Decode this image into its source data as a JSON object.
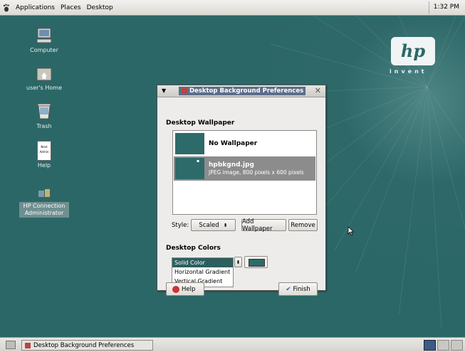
{
  "top_panel": {
    "menus": [
      "Applications",
      "Places",
      "Desktop"
    ],
    "clock": "1:32 PM"
  },
  "desktop_icons": [
    {
      "label": "Computer",
      "icon": "computer-icon"
    },
    {
      "label": "user's Home",
      "icon": "home-folder-icon"
    },
    {
      "label": "Trash",
      "icon": "trash-icon"
    },
    {
      "label": "Help",
      "icon": "help-document-icon"
    },
    {
      "label": "HP Connection Administrator",
      "icon": "network-admin-icon"
    }
  ],
  "help_icon_doc": {
    "line1": "Next",
    "line2": "Admin"
  },
  "branding": {
    "logo": "hp",
    "tagline": "invent"
  },
  "dialog": {
    "title": "Desktop Background Preferences",
    "wallpaper_heading": "Desktop Wallpaper",
    "wallpapers": [
      {
        "name": "No Wallpaper",
        "description": ""
      },
      {
        "name": "hpbkgnd.jpg",
        "description": "JPEG image, 800 pixels x 600 pixels",
        "selected": true
      }
    ],
    "style_label": "Style:",
    "style_value": "Scaled",
    "add_wallpaper_label": "Add Wallpaper",
    "remove_label": "Remove",
    "colors_heading": "Desktop Colors",
    "color_options": [
      "Solid Color",
      "Horizontal Gradient",
      "Vertical Gradient"
    ],
    "selected_color_option": "Solid Color",
    "swatch_color": "#2d6a6a",
    "help_label": "Help",
    "finish_label": "Finish"
  },
  "taskbar": {
    "task_label": "Desktop Background Preferences"
  },
  "colors": {
    "desktop_bg": "#2c6767",
    "selection": "#2c5f5f"
  }
}
